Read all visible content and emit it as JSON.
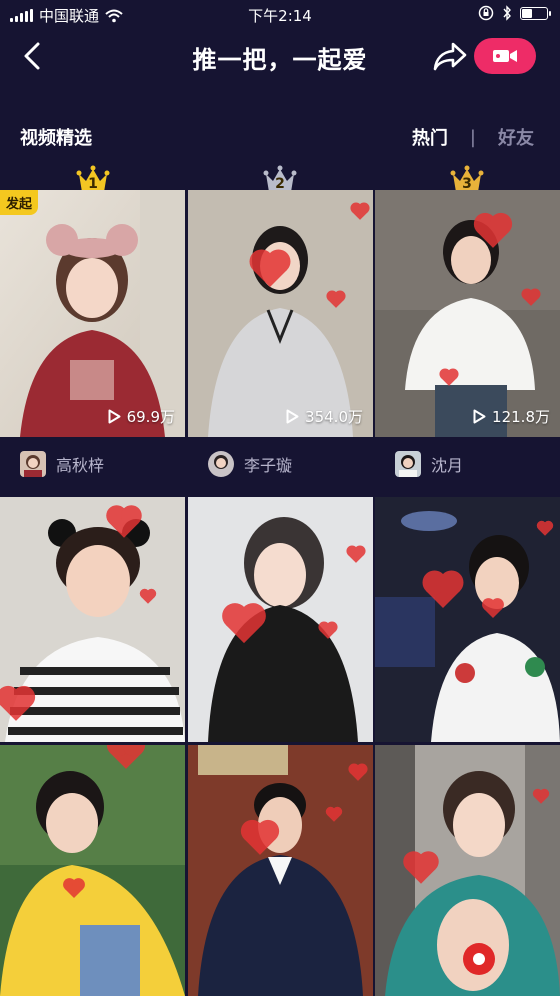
{
  "status_bar": {
    "carrier": "中国联通",
    "time": "下午2:14",
    "battery_level": 0.45
  },
  "nav": {
    "title": "推一把，一起爱",
    "icons": [
      "back-icon",
      "share-icon",
      "video-camera-icon"
    ]
  },
  "section": {
    "title": "视频精选",
    "tabs": [
      {
        "label": "热门",
        "active": true
      },
      {
        "label": "好友",
        "active": false
      }
    ],
    "separator": "|"
  },
  "featured": [
    {
      "rank": "1",
      "badge": "发起",
      "plays": "69.9万",
      "creator": "高秋梓",
      "crown_color": "#f3c623"
    },
    {
      "rank": "2",
      "badge": "",
      "plays": "354.0万",
      "creator": "李子璇",
      "crown_color": "#b9bccb"
    },
    {
      "rank": "3",
      "badge": "",
      "plays": "121.8万",
      "creator": "沈月",
      "crown_color": "#e8b23a"
    }
  ],
  "colors": {
    "background": "#161432",
    "accent": "#ee2c67",
    "muted_text": "#8a88a6"
  }
}
